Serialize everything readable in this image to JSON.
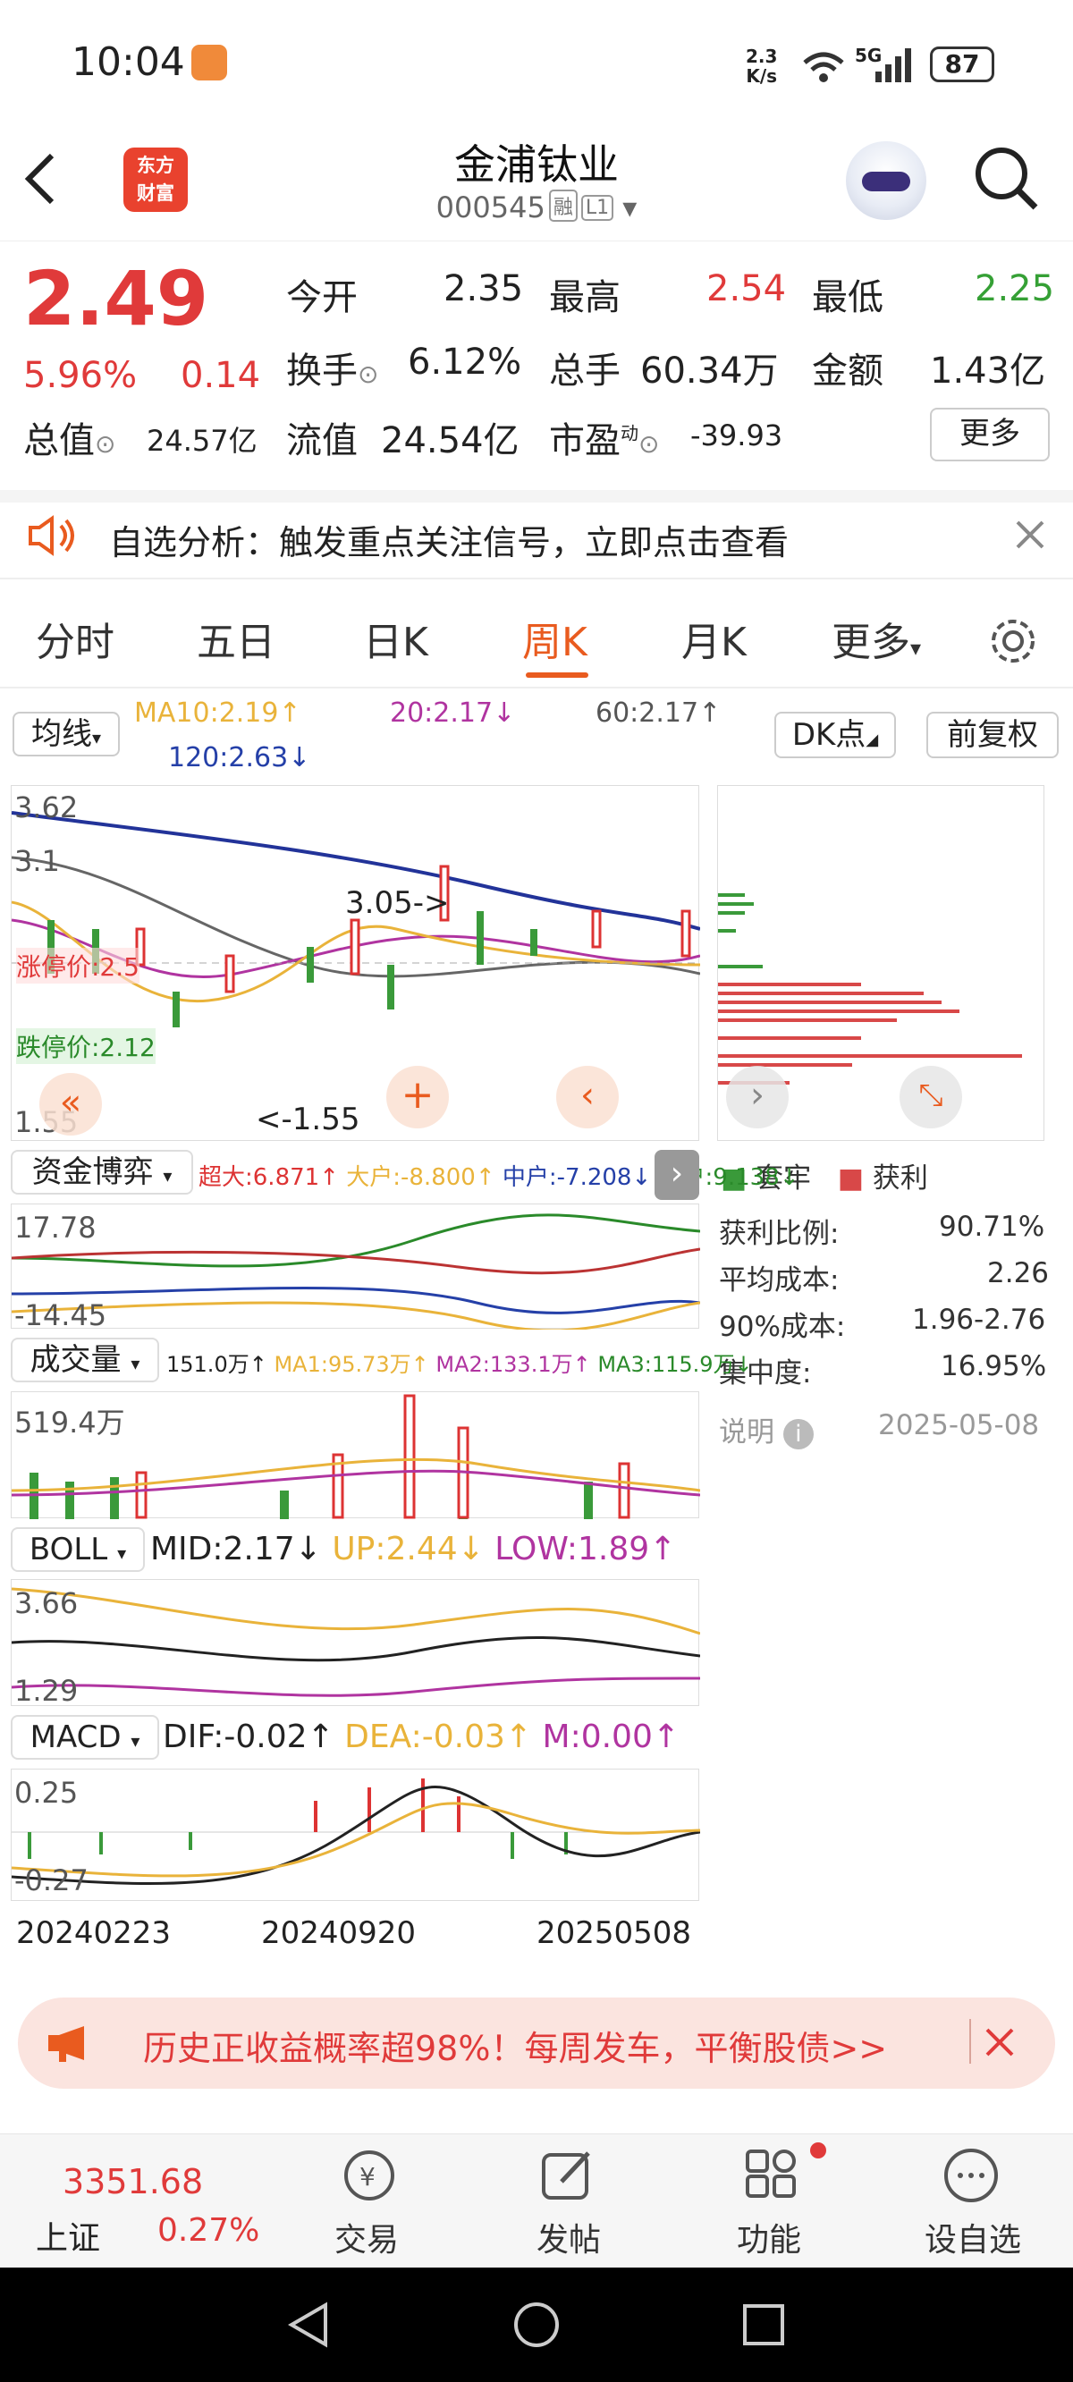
{
  "status": {
    "time": "10:04",
    "net_speed_top": "2.3",
    "net_speed_bottom": "K/s",
    "signal": "5G",
    "battery": "87"
  },
  "header": {
    "logo_line1": "东方",
    "logo_line2": "财富",
    "title": "金浦钛业",
    "code": "000545",
    "tag1": "融",
    "tag2": "L1"
  },
  "quote": {
    "price": "2.49",
    "pct": "5.96%",
    "chg": "0.14",
    "open_l": "今开",
    "open": "2.35",
    "high_l": "最高",
    "high": "2.54",
    "low_l": "最低",
    "low": "2.25",
    "turn_l": "换手",
    "turn": "6.12%",
    "vol_l": "总手",
    "vol": "60.34万",
    "amt_l": "金额",
    "amt": "1.43亿",
    "mcap_l": "总值",
    "mcap": "24.57亿",
    "fcap_l": "流值",
    "fcap": "24.54亿",
    "pe_l": "市盈",
    "pe_sup": "动",
    "pe": "-39.93",
    "more": "更多"
  },
  "notice": {
    "text": "自选分析：触发重点关注信号，立即点击查看"
  },
  "tabs": [
    "分时",
    "五日",
    "日K",
    "周K",
    "月K",
    "更多"
  ],
  "ma": {
    "type": "均线",
    "ma10": "MA10:2.19↑",
    "ma20": "20:2.17↓",
    "ma60": "60:2.17↑",
    "ma120": "120:2.63↓",
    "dk": "DK点",
    "fq": "前复权"
  },
  "kchart": {
    "max": "3.62",
    "y2": "3.1",
    "min": "1.55",
    "hi_note": "3.05->",
    "lo_note": "<-1.55",
    "limit_up": "涨停价:2.5",
    "limit_down": "跌停价:2.12"
  },
  "fund": {
    "label": "资金博弈",
    "super": "超大:6.871↑",
    "big": "大户:-8.800↑",
    "mid": "中户:-7.208↓",
    "small": "小户:9.138↓",
    "max": "17.78",
    "min": "-14.45"
  },
  "volume": {
    "label": "成交量",
    "v": "151.0万↑",
    "ma1": "MA1:95.73万↑",
    "ma2": "MA2:133.1万↑",
    "ma3": "MA3:115.9万↓",
    "max": "519.4万"
  },
  "boll": {
    "label": "BOLL",
    "mid": "MID:2.17↓",
    "up": "UP:2.44↓",
    "low": "LOW:1.89↑",
    "max": "3.66",
    "min": "1.29"
  },
  "macd": {
    "label": "MACD",
    "dif": "DIF:-0.02↑",
    "dea": "DEA:-0.03↑",
    "m": "M:0.00↑",
    "max": "0.25",
    "min": "-0.27"
  },
  "dates": [
    "20240223",
    "20240920",
    "20250508"
  ],
  "chips": {
    "legend1": "套牢",
    "legend2": "获利",
    "rows": [
      [
        "获利比例:",
        "90.71%"
      ],
      [
        "平均成本:",
        "2.26"
      ],
      [
        "90%成本:",
        "1.96-2.76"
      ],
      [
        "集中度:",
        "16.95%"
      ]
    ],
    "note": "说明",
    "date": "2025-05-08"
  },
  "ad": {
    "text": "历史正收益概率超98%！每周发车，平衡股债>>"
  },
  "bottom": {
    "index_val": "3351.68",
    "index_name": "上证",
    "index_pct": "0.27%",
    "b1": "交易",
    "b2": "发帖",
    "b3": "功能",
    "b4": "设自选"
  }
}
